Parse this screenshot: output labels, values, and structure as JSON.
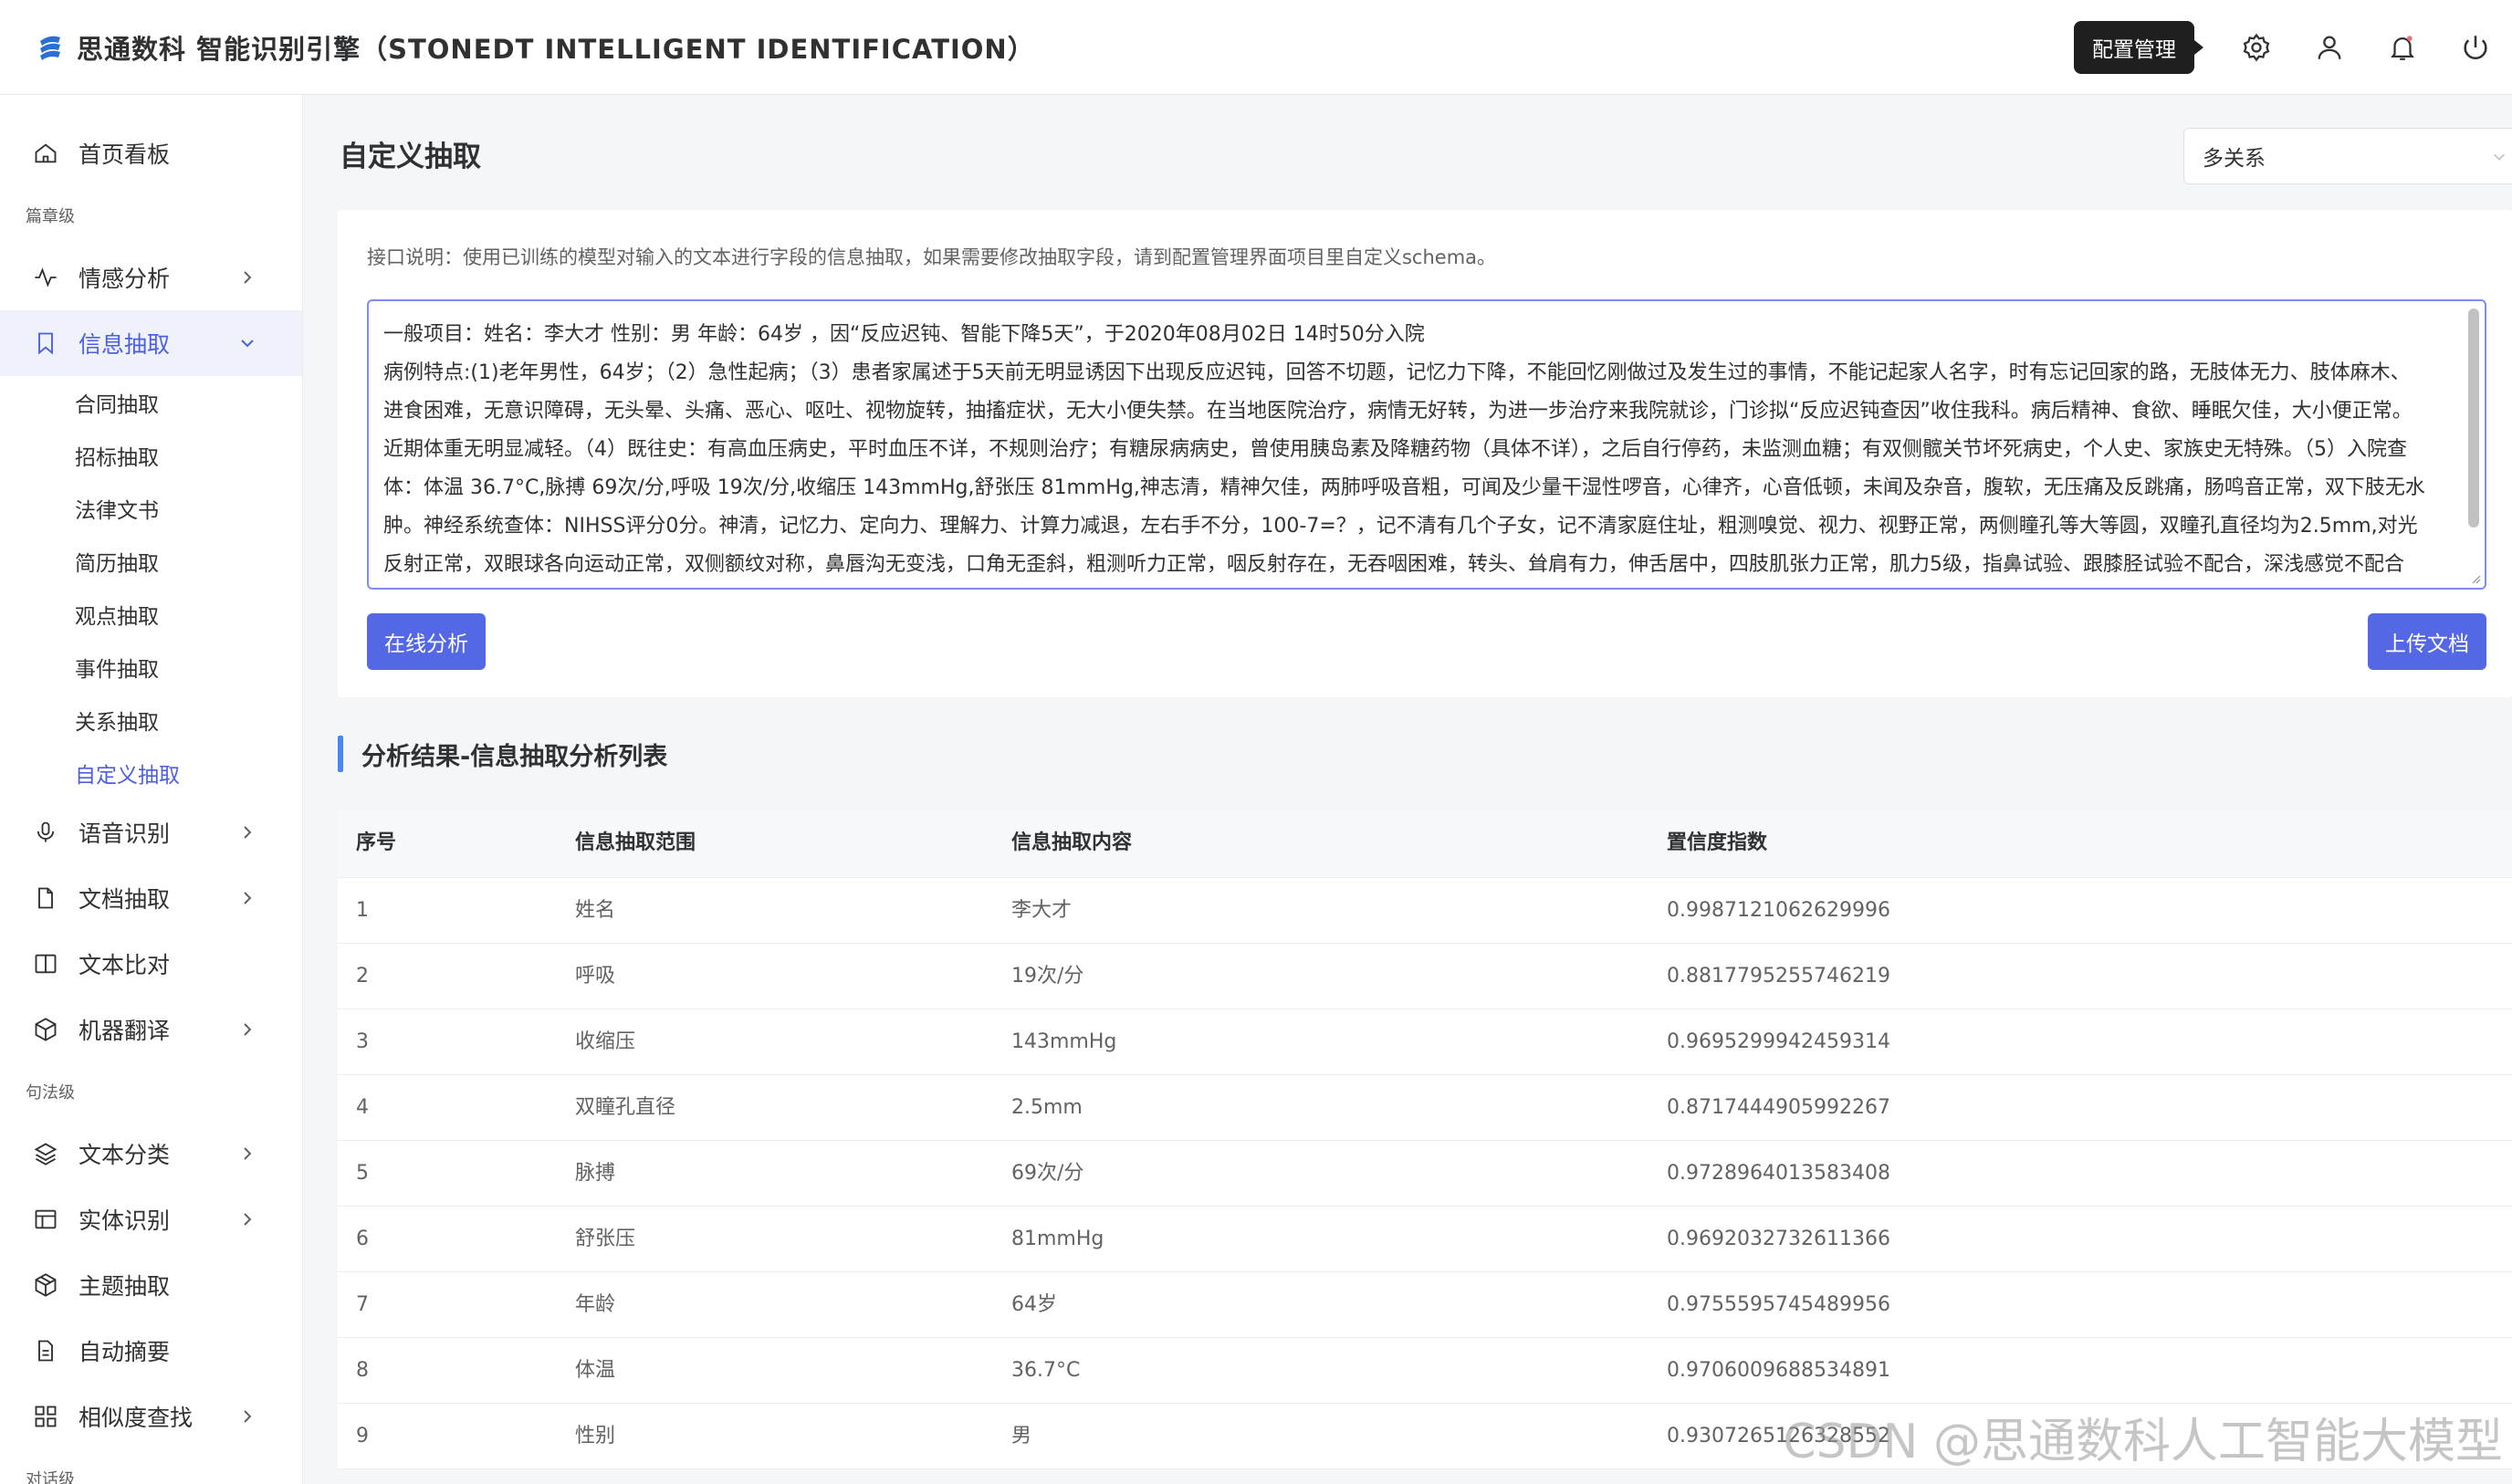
{
  "header": {
    "brand": "思通数科 智能识别引擎（STONEDT INTELLIGENT IDENTIFICATION）",
    "tooltip": "配置管理",
    "icons": [
      "gear-icon",
      "user-icon",
      "bell-icon",
      "power-icon"
    ]
  },
  "sidebar": {
    "home": "首页看板",
    "group1": "篇章级",
    "sentiment": "情感分析",
    "info_extract": "信息抽取",
    "sub": [
      "合同抽取",
      "招标抽取",
      "法律文书",
      "简历抽取",
      "观点抽取",
      "事件抽取",
      "关系抽取",
      "自定义抽取"
    ],
    "speech": "语音识别",
    "doc_extract": "文档抽取",
    "text_compare": "文本比对",
    "translate": "机器翻译",
    "group2": "句法级",
    "text_classify": "文本分类",
    "entity": "实体识别",
    "topic": "主题抽取",
    "summary": "自动摘要",
    "similarity": "相似度查找",
    "group3": "对话级"
  },
  "main": {
    "title": "自定义抽取",
    "select_value": "多关系",
    "description": "接口说明：使用已训练的模型对输入的文本进行字段的信息抽取，如果需要修改抽取字段，请到配置管理界面项目里自定义schema。",
    "text_lines": [
      "一般项目：姓名：李大才 性别：男 年龄：64岁 ，因“反应迟钝、智能下降5天”，于2020年08月02日 14时50分入院",
      "病例特点:(1)老年男性，64岁；（2）急性起病；（3）患者家属述于5天前无明显诱因下出现反应迟钝，回答不切题，记忆力下降，不能回忆刚做过及发生过的事情，不能记起家人名字，时有忘记回家的路，无肢体无力、肢体麻木、",
      "进食困难，无意识障碍，无头晕、头痛、恶心、呕吐、视物旋转，抽搐症状，无大小便失禁。在当地医院治疗，病情无好转，为进一步治疗来我院就诊，门诊拟“反应迟钝查因”收住我科。病后精神、食欲、睡眠欠佳，大小便正常。",
      "近期体重无明显减轻。（4）既往史：有高血压病史，平时血压不详，不规则治疗；有糖尿病病史，曾使用胰岛素及降糖药物（具体不详），之后自行停药，未监测血糖；有双侧髋关节坏死病史，个人史、家族史无特殊。（5）入院查",
      "体：体温 36.7°C,脉搏 69次/分,呼吸 19次/分,收缩压 143mmHg,舒张压 81mmHg,神志清，精神欠佳，两肺呼吸音粗，可闻及少量干湿性啰音，心律齐，心音低顿，未闻及杂音，腹软，无压痛及反跳痛，肠鸣音正常，双下肢无水",
      "肿。神经系统查体：NIHSS评分0分。神清，记忆力、定向力、理解力、计算力减退，左右手不分，100-7=？，记不清有几个子女，记不清家庭住址，粗测嗅觉、视力、视野正常，两侧瞳孔等大等圆，双瞳孔直径均为2.5mm,对光",
      "反射正常，双眼球各向运动正常，双侧额纹对称，鼻唇沟无变浅，口角无歪斜，粗测听力正常，咽反射存在，无吞咽困难，转头、耸肩有力，伸舌居中，四肢肌张力正常，肌力5级，指鼻试验、跟膝胫试验不配合，深浅感觉不配合"
    ],
    "btn_analyze": "在线分析",
    "btn_upload": "上传文档",
    "section_title": "分析结果-信息抽取分析列表",
    "table": {
      "headers": [
        "序号",
        "信息抽取范围",
        "信息抽取内容",
        "置信度指数"
      ],
      "rows": [
        [
          "1",
          "姓名",
          "李大才",
          "0.9987121062629996"
        ],
        [
          "2",
          "呼吸",
          "19次/分",
          "0.8817795255746219"
        ],
        [
          "3",
          "收缩压",
          "143mmHg",
          "0.9695299942459314"
        ],
        [
          "4",
          "双瞳孔直径",
          "2.5mm",
          "0.8717444905992267"
        ],
        [
          "5",
          "脉搏",
          "69次/分",
          "0.9728964013583408"
        ],
        [
          "6",
          "舒张压",
          "81mmHg",
          "0.9692032732611366"
        ],
        [
          "7",
          "年龄",
          "64岁",
          "0.9755595745489956"
        ],
        [
          "8",
          "体温",
          "36.7°C",
          "0.9706009688534891"
        ],
        [
          "9",
          "性别",
          "男",
          "0.9307265126328552"
        ]
      ]
    }
  },
  "watermark": "CSDN @思通数科人工智能大模型",
  "colors": {
    "accent": "#4b5fe0",
    "button": "#5468e6",
    "section_bar": "#4b86f0"
  }
}
